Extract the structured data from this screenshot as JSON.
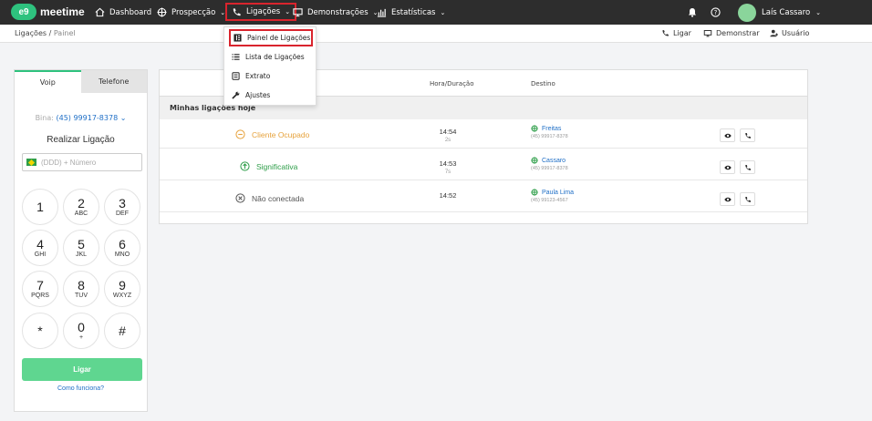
{
  "brand": {
    "badge": "e9",
    "name": "meetime",
    "color": "#2ec27e"
  },
  "nav": {
    "dashboard": "Dashboard",
    "prospeccao": "Prospecção",
    "ligacoes": "Ligações",
    "demonstracoes": "Demonstrações",
    "estatisticas": "Estatísticas",
    "caret": "⌄"
  },
  "user": {
    "name": "Laís Cassaro"
  },
  "breadcrumb": {
    "parent": "Ligações /",
    "current": "Painel"
  },
  "actions": {
    "ligar": "Ligar",
    "demonstrar": "Demonstrar",
    "usuario": "Usuário"
  },
  "dropdown": {
    "items": [
      {
        "label": "Painel de Ligações",
        "icon": "panel-icon"
      },
      {
        "label": "Lista de Ligações",
        "icon": "list-icon"
      },
      {
        "label": "Extrato",
        "icon": "receipt-icon"
      },
      {
        "label": "Ajustes",
        "icon": "wrench-icon"
      }
    ]
  },
  "dialer": {
    "tabs": [
      "Voip",
      "Telefone"
    ],
    "bina_label": "Bina:",
    "bina_number": "(45) 99917-8378",
    "title": "Realizar Ligação",
    "phone_placeholder": "(DDD) + Número",
    "keys": [
      {
        "num": "1",
        "sub": ""
      },
      {
        "num": "2",
        "sub": "ABC"
      },
      {
        "num": "3",
        "sub": "DEF"
      },
      {
        "num": "4",
        "sub": "GHI"
      },
      {
        "num": "5",
        "sub": "JKL"
      },
      {
        "num": "6",
        "sub": "MNO"
      },
      {
        "num": "7",
        "sub": "PQRS"
      },
      {
        "num": "8",
        "sub": "TUV"
      },
      {
        "num": "9",
        "sub": "WXYZ"
      },
      {
        "num": "*",
        "sub": ""
      },
      {
        "num": "0",
        "sub": "+"
      },
      {
        "num": "#",
        "sub": ""
      }
    ],
    "call_button": "Ligar",
    "help_link": "Como funciona?"
  },
  "table": {
    "headers": {
      "hora": "Hora/Duração",
      "destino": "Destino"
    },
    "section_title": "Minhas ligações hoje",
    "rows": [
      {
        "status": "Cliente Ocupado",
        "status_color": "#e6a23c",
        "time": "14:54",
        "duration": "2s",
        "dest_name": "Freitas",
        "dest_number": "(45) 99917-8378"
      },
      {
        "status": "Significativa",
        "status_color": "#2e9e49",
        "time": "14:53",
        "duration": "7s",
        "dest_name": "Cassaro",
        "dest_number": "(45) 99917-8378"
      },
      {
        "status": "Não conectada",
        "status_color": "#555555",
        "time": "14:52",
        "duration": "",
        "dest_name": "Paula Lima",
        "dest_number": "(45) 99123-4567"
      }
    ]
  },
  "colors": {
    "accent": "#2ec27e",
    "highlight": "#d9242d",
    "link": "#1f6fc6"
  }
}
